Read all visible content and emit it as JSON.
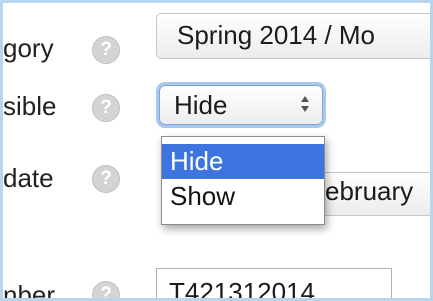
{
  "form": {
    "category": {
      "label": "gory",
      "value": "Spring 2014 / Mo"
    },
    "visible": {
      "label": "sible",
      "selected": "Hide",
      "options": [
        "Hide",
        "Show"
      ]
    },
    "start_date": {
      "label": "date",
      "partial_value": "ebruary"
    },
    "id_number": {
      "label": "nber",
      "value": "T421312014"
    }
  },
  "icons": {
    "help": "question-mark-circle-icon",
    "select_arrows": "updown-arrows-icon"
  },
  "colors": {
    "frame_border": "#b7d5ec",
    "focus_ring": "#a9c8ec",
    "selected_option_bg": "#3d74e0",
    "help_icon_bg": "#d4d4d4"
  },
  "help_glyph": "?"
}
